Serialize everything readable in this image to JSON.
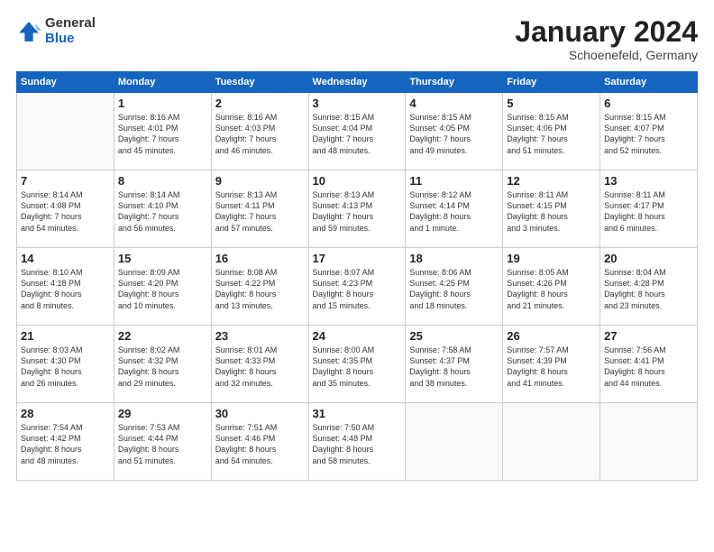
{
  "header": {
    "logo_general": "General",
    "logo_blue": "Blue",
    "title": "January 2024",
    "subtitle": "Schoenefeld, Germany"
  },
  "days_of_week": [
    "Sunday",
    "Monday",
    "Tuesday",
    "Wednesday",
    "Thursday",
    "Friday",
    "Saturday"
  ],
  "weeks": [
    [
      {
        "num": "",
        "info": ""
      },
      {
        "num": "1",
        "info": "Sunrise: 8:16 AM\nSunset: 4:01 PM\nDaylight: 7 hours\nand 45 minutes."
      },
      {
        "num": "2",
        "info": "Sunrise: 8:16 AM\nSunset: 4:03 PM\nDaylight: 7 hours\nand 46 minutes."
      },
      {
        "num": "3",
        "info": "Sunrise: 8:15 AM\nSunset: 4:04 PM\nDaylight: 7 hours\nand 48 minutes."
      },
      {
        "num": "4",
        "info": "Sunrise: 8:15 AM\nSunset: 4:05 PM\nDaylight: 7 hours\nand 49 minutes."
      },
      {
        "num": "5",
        "info": "Sunrise: 8:15 AM\nSunset: 4:06 PM\nDaylight: 7 hours\nand 51 minutes."
      },
      {
        "num": "6",
        "info": "Sunrise: 8:15 AM\nSunset: 4:07 PM\nDaylight: 7 hours\nand 52 minutes."
      }
    ],
    [
      {
        "num": "7",
        "info": "Sunrise: 8:14 AM\nSunset: 4:08 PM\nDaylight: 7 hours\nand 54 minutes."
      },
      {
        "num": "8",
        "info": "Sunrise: 8:14 AM\nSunset: 4:10 PM\nDaylight: 7 hours\nand 56 minutes."
      },
      {
        "num": "9",
        "info": "Sunrise: 8:13 AM\nSunset: 4:11 PM\nDaylight: 7 hours\nand 57 minutes."
      },
      {
        "num": "10",
        "info": "Sunrise: 8:13 AM\nSunset: 4:13 PM\nDaylight: 7 hours\nand 59 minutes."
      },
      {
        "num": "11",
        "info": "Sunrise: 8:12 AM\nSunset: 4:14 PM\nDaylight: 8 hours\nand 1 minute."
      },
      {
        "num": "12",
        "info": "Sunrise: 8:11 AM\nSunset: 4:15 PM\nDaylight: 8 hours\nand 3 minutes."
      },
      {
        "num": "13",
        "info": "Sunrise: 8:11 AM\nSunset: 4:17 PM\nDaylight: 8 hours\nand 6 minutes."
      }
    ],
    [
      {
        "num": "14",
        "info": "Sunrise: 8:10 AM\nSunset: 4:18 PM\nDaylight: 8 hours\nand 8 minutes."
      },
      {
        "num": "15",
        "info": "Sunrise: 8:09 AM\nSunset: 4:20 PM\nDaylight: 8 hours\nand 10 minutes."
      },
      {
        "num": "16",
        "info": "Sunrise: 8:08 AM\nSunset: 4:22 PM\nDaylight: 8 hours\nand 13 minutes."
      },
      {
        "num": "17",
        "info": "Sunrise: 8:07 AM\nSunset: 4:23 PM\nDaylight: 8 hours\nand 15 minutes."
      },
      {
        "num": "18",
        "info": "Sunrise: 8:06 AM\nSunset: 4:25 PM\nDaylight: 8 hours\nand 18 minutes."
      },
      {
        "num": "19",
        "info": "Sunrise: 8:05 AM\nSunset: 4:26 PM\nDaylight: 8 hours\nand 21 minutes."
      },
      {
        "num": "20",
        "info": "Sunrise: 8:04 AM\nSunset: 4:28 PM\nDaylight: 8 hours\nand 23 minutes."
      }
    ],
    [
      {
        "num": "21",
        "info": "Sunrise: 8:03 AM\nSunset: 4:30 PM\nDaylight: 8 hours\nand 26 minutes."
      },
      {
        "num": "22",
        "info": "Sunrise: 8:02 AM\nSunset: 4:32 PM\nDaylight: 8 hours\nand 29 minutes."
      },
      {
        "num": "23",
        "info": "Sunrise: 8:01 AM\nSunset: 4:33 PM\nDaylight: 8 hours\nand 32 minutes."
      },
      {
        "num": "24",
        "info": "Sunrise: 8:00 AM\nSunset: 4:35 PM\nDaylight: 8 hours\nand 35 minutes."
      },
      {
        "num": "25",
        "info": "Sunrise: 7:58 AM\nSunset: 4:37 PM\nDaylight: 8 hours\nand 38 minutes."
      },
      {
        "num": "26",
        "info": "Sunrise: 7:57 AM\nSunset: 4:39 PM\nDaylight: 8 hours\nand 41 minutes."
      },
      {
        "num": "27",
        "info": "Sunrise: 7:56 AM\nSunset: 4:41 PM\nDaylight: 8 hours\nand 44 minutes."
      }
    ],
    [
      {
        "num": "28",
        "info": "Sunrise: 7:54 AM\nSunset: 4:42 PM\nDaylight: 8 hours\nand 48 minutes."
      },
      {
        "num": "29",
        "info": "Sunrise: 7:53 AM\nSunset: 4:44 PM\nDaylight: 8 hours\nand 51 minutes."
      },
      {
        "num": "30",
        "info": "Sunrise: 7:51 AM\nSunset: 4:46 PM\nDaylight: 8 hours\nand 54 minutes."
      },
      {
        "num": "31",
        "info": "Sunrise: 7:50 AM\nSunset: 4:48 PM\nDaylight: 8 hours\nand 58 minutes."
      },
      {
        "num": "",
        "info": ""
      },
      {
        "num": "",
        "info": ""
      },
      {
        "num": "",
        "info": ""
      }
    ]
  ]
}
